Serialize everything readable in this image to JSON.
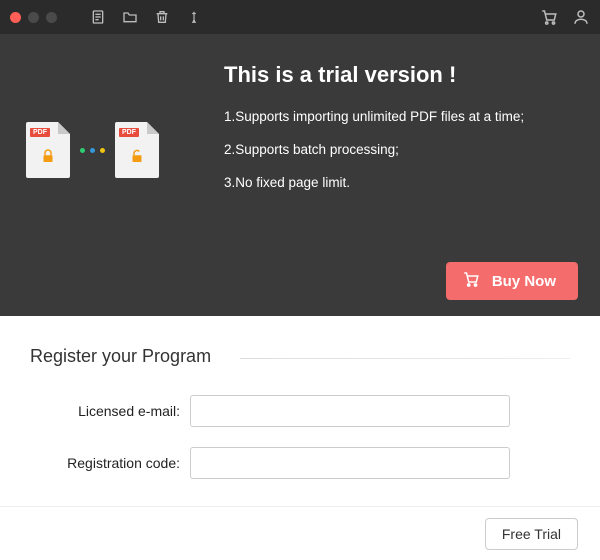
{
  "hero": {
    "title": "This is a trial version !",
    "features": [
      "1.Supports importing unlimited PDF files at a time;",
      "2.Supports batch processing;",
      "3.No fixed page limit."
    ],
    "pdf_tag": "PDF",
    "buy_label": "Buy Now"
  },
  "register": {
    "heading": "Register your Program",
    "email_label": "Licensed e-mail:",
    "code_label": "Registration code:",
    "email_value": "",
    "code_value": ""
  },
  "footer": {
    "trial_label": "Free Trial"
  }
}
